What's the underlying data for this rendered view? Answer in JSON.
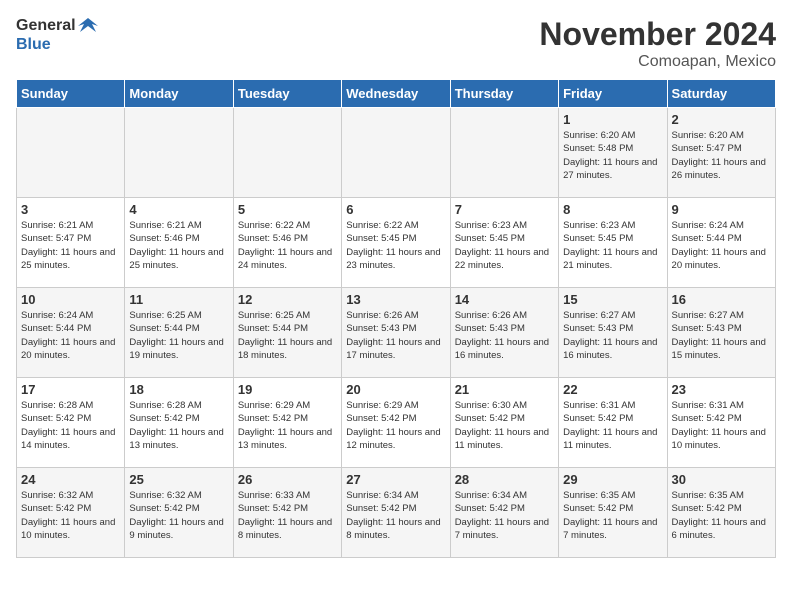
{
  "logo": {
    "line1": "General",
    "line2": "Blue"
  },
  "title": "November 2024",
  "subtitle": "Comoapan, Mexico",
  "days_of_week": [
    "Sunday",
    "Monday",
    "Tuesday",
    "Wednesday",
    "Thursday",
    "Friday",
    "Saturday"
  ],
  "weeks": [
    [
      {
        "day": "",
        "info": ""
      },
      {
        "day": "",
        "info": ""
      },
      {
        "day": "",
        "info": ""
      },
      {
        "day": "",
        "info": ""
      },
      {
        "day": "",
        "info": ""
      },
      {
        "day": "1",
        "info": "Sunrise: 6:20 AM\nSunset: 5:48 PM\nDaylight: 11 hours and 27 minutes."
      },
      {
        "day": "2",
        "info": "Sunrise: 6:20 AM\nSunset: 5:47 PM\nDaylight: 11 hours and 26 minutes."
      }
    ],
    [
      {
        "day": "3",
        "info": "Sunrise: 6:21 AM\nSunset: 5:47 PM\nDaylight: 11 hours and 25 minutes."
      },
      {
        "day": "4",
        "info": "Sunrise: 6:21 AM\nSunset: 5:46 PM\nDaylight: 11 hours and 25 minutes."
      },
      {
        "day": "5",
        "info": "Sunrise: 6:22 AM\nSunset: 5:46 PM\nDaylight: 11 hours and 24 minutes."
      },
      {
        "day": "6",
        "info": "Sunrise: 6:22 AM\nSunset: 5:45 PM\nDaylight: 11 hours and 23 minutes."
      },
      {
        "day": "7",
        "info": "Sunrise: 6:23 AM\nSunset: 5:45 PM\nDaylight: 11 hours and 22 minutes."
      },
      {
        "day": "8",
        "info": "Sunrise: 6:23 AM\nSunset: 5:45 PM\nDaylight: 11 hours and 21 minutes."
      },
      {
        "day": "9",
        "info": "Sunrise: 6:24 AM\nSunset: 5:44 PM\nDaylight: 11 hours and 20 minutes."
      }
    ],
    [
      {
        "day": "10",
        "info": "Sunrise: 6:24 AM\nSunset: 5:44 PM\nDaylight: 11 hours and 20 minutes."
      },
      {
        "day": "11",
        "info": "Sunrise: 6:25 AM\nSunset: 5:44 PM\nDaylight: 11 hours and 19 minutes."
      },
      {
        "day": "12",
        "info": "Sunrise: 6:25 AM\nSunset: 5:44 PM\nDaylight: 11 hours and 18 minutes."
      },
      {
        "day": "13",
        "info": "Sunrise: 6:26 AM\nSunset: 5:43 PM\nDaylight: 11 hours and 17 minutes."
      },
      {
        "day": "14",
        "info": "Sunrise: 6:26 AM\nSunset: 5:43 PM\nDaylight: 11 hours and 16 minutes."
      },
      {
        "day": "15",
        "info": "Sunrise: 6:27 AM\nSunset: 5:43 PM\nDaylight: 11 hours and 16 minutes."
      },
      {
        "day": "16",
        "info": "Sunrise: 6:27 AM\nSunset: 5:43 PM\nDaylight: 11 hours and 15 minutes."
      }
    ],
    [
      {
        "day": "17",
        "info": "Sunrise: 6:28 AM\nSunset: 5:42 PM\nDaylight: 11 hours and 14 minutes."
      },
      {
        "day": "18",
        "info": "Sunrise: 6:28 AM\nSunset: 5:42 PM\nDaylight: 11 hours and 13 minutes."
      },
      {
        "day": "19",
        "info": "Sunrise: 6:29 AM\nSunset: 5:42 PM\nDaylight: 11 hours and 13 minutes."
      },
      {
        "day": "20",
        "info": "Sunrise: 6:29 AM\nSunset: 5:42 PM\nDaylight: 11 hours and 12 minutes."
      },
      {
        "day": "21",
        "info": "Sunrise: 6:30 AM\nSunset: 5:42 PM\nDaylight: 11 hours and 11 minutes."
      },
      {
        "day": "22",
        "info": "Sunrise: 6:31 AM\nSunset: 5:42 PM\nDaylight: 11 hours and 11 minutes."
      },
      {
        "day": "23",
        "info": "Sunrise: 6:31 AM\nSunset: 5:42 PM\nDaylight: 11 hours and 10 minutes."
      }
    ],
    [
      {
        "day": "24",
        "info": "Sunrise: 6:32 AM\nSunset: 5:42 PM\nDaylight: 11 hours and 10 minutes."
      },
      {
        "day": "25",
        "info": "Sunrise: 6:32 AM\nSunset: 5:42 PM\nDaylight: 11 hours and 9 minutes."
      },
      {
        "day": "26",
        "info": "Sunrise: 6:33 AM\nSunset: 5:42 PM\nDaylight: 11 hours and 8 minutes."
      },
      {
        "day": "27",
        "info": "Sunrise: 6:34 AM\nSunset: 5:42 PM\nDaylight: 11 hours and 8 minutes."
      },
      {
        "day": "28",
        "info": "Sunrise: 6:34 AM\nSunset: 5:42 PM\nDaylight: 11 hours and 7 minutes."
      },
      {
        "day": "29",
        "info": "Sunrise: 6:35 AM\nSunset: 5:42 PM\nDaylight: 11 hours and 7 minutes."
      },
      {
        "day": "30",
        "info": "Sunrise: 6:35 AM\nSunset: 5:42 PM\nDaylight: 11 hours and 6 minutes."
      }
    ]
  ]
}
